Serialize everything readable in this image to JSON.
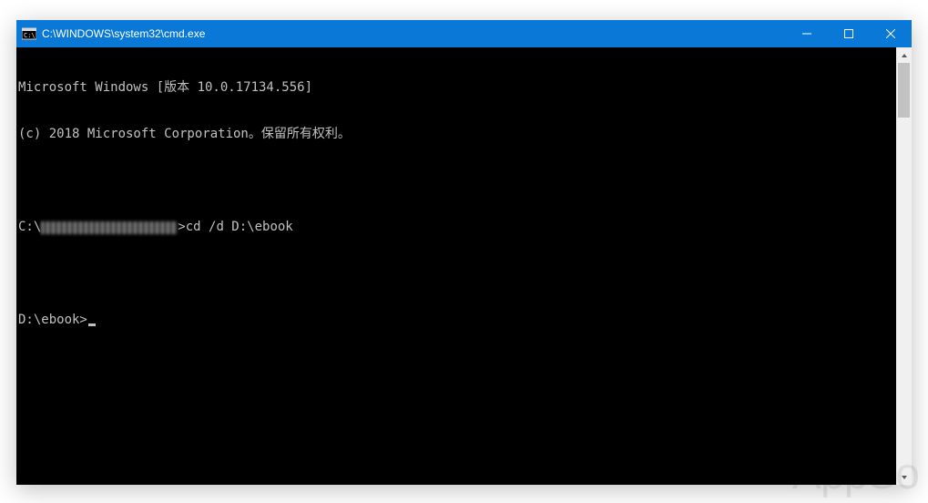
{
  "window": {
    "title": "C:\\WINDOWS\\system32\\cmd.exe"
  },
  "console": {
    "line1": "Microsoft Windows [版本 10.0.17134.556]",
    "line2": "(c) 2018 Microsoft Corporation。保留所有权利。",
    "prompt1_prefix": "C:\\",
    "prompt1_suffix": ">",
    "command1": "cd /d D:\\ebook",
    "prompt2": "D:\\ebook>"
  },
  "watermark": "AppSo"
}
